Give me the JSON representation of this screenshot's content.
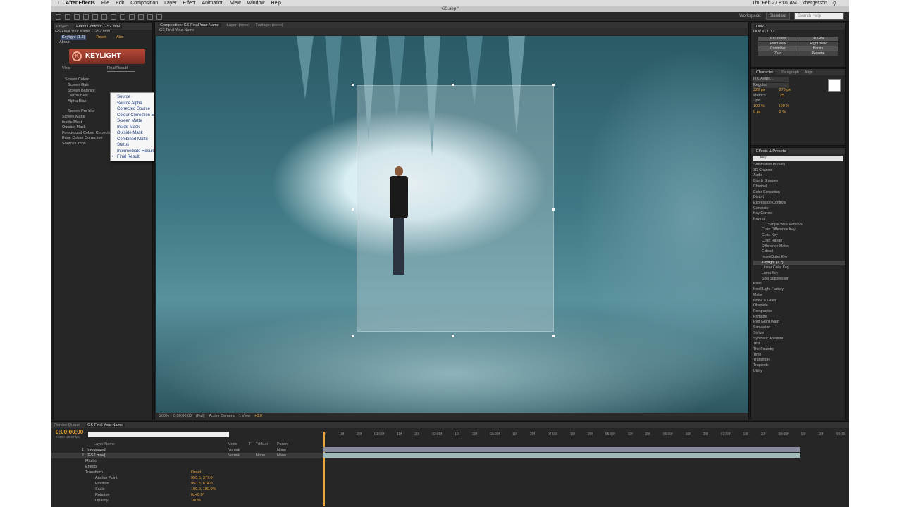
{
  "menubar": {
    "app": "After Effects",
    "items": [
      "File",
      "Edit",
      "Composition",
      "Layer",
      "Effect",
      "Animation",
      "View",
      "Window",
      "Help"
    ],
    "clock": "Thu Feb 27  8:01 AM",
    "user": "kbergerson"
  },
  "window_title": "GS.aep *",
  "workspace": {
    "label": "Workspace:",
    "value": "Standard",
    "search_placeholder": "Search Help"
  },
  "effect_panel": {
    "tabs": [
      "Project",
      "Effect Controls: GS2.mov"
    ],
    "layer": "GS Final Your Name • GS2.mov",
    "effect_name": "Keylight (1.2)",
    "reset": "Reset",
    "about_short": "Abo",
    "about": "About",
    "logo_text": "KEYLIGHT",
    "view_label": "View",
    "view_value": "Final Result",
    "items": [
      "Screen Colour",
      "Screen Gain",
      "Screen Balance",
      "Despill Bias",
      "Alpha Bias",
      "Screen Pre-blur",
      "Screen Matte",
      "Inside Mask",
      "Outside Mask",
      "Foreground Colour Correctio",
      "Edge Colour Correction",
      "Source Crops"
    ],
    "dropdown": [
      "Source",
      "Source Alpha",
      "Corrected Source",
      "Colour Correction Edges",
      "Screen Matte",
      "Inside Mask",
      "Outside Mask",
      "Combined Matte",
      "Status",
      "Intermediate Result",
      "Final Result"
    ],
    "dropdown_selected": "Final Result"
  },
  "viewer": {
    "tab": "Composition: GS Final Your Name",
    "layer_tab": "Layer: (none)",
    "footage_tab": "Footage: (none)",
    "comp_tab": "GS Final Your Name",
    "bottom": [
      "200%",
      "0;00;00;00",
      "(Full)",
      "Active Camera",
      "1 View",
      "+0.0"
    ]
  },
  "duik": {
    "title": "Duik",
    "version": "Duik v13.0.2",
    "buttons": [
      "3D Creator",
      "3D Goal",
      "Front view",
      "Right view",
      "Controller",
      "Bones",
      "Zero",
      "Rename"
    ]
  },
  "character": {
    "tabs": [
      "Character",
      "Paragraph",
      "Align"
    ],
    "font": "ITC Avant...",
    "style": "Regular",
    "size": "229 px",
    "leading": "278 px",
    "kerning": "Metrics",
    "tracking": "25",
    "unit": "- px",
    "vscale": "100 %",
    "hscale": "100 %",
    "baseline": "0 px",
    "tsume": "0 %"
  },
  "effects_presets": {
    "title": "Effects & Presets",
    "search": "key",
    "items": [
      "* Animation Presets",
      "3D Channel",
      "Audio",
      "Blur & Sharpen",
      "Channel",
      "Color Correction",
      "Distort",
      "Expression Controls",
      "Generate",
      "Key Correct",
      "Keying"
    ],
    "keying": [
      "CC Simple Wire Removal",
      "Color Difference Key",
      "Color Key",
      "Color Range",
      "Difference Matte",
      "Extract",
      "Inner/Outer Key",
      "Keylight (1.2)",
      "Linear Color Key",
      "Luma Key",
      "Spill Suppressor"
    ],
    "more": [
      "Knoll",
      "Knoll Light Factory",
      "Matte",
      "Noise & Grain",
      "Obsolete",
      "Perspective",
      "Primatte",
      "Red Giant Warp",
      "Simulation",
      "Stylize",
      "Synthetic Aperture",
      "Text",
      "The Foundry",
      "Time",
      "Transition",
      "Trapcode",
      "Utility"
    ]
  },
  "timeline": {
    "tabs": [
      "Render Queue",
      "GS Final Your Name"
    ],
    "timecode": "0;00;00;00",
    "frames": "00000 (29.97 fps)",
    "search": "",
    "headers": [
      "Layer Name",
      "Mode",
      "T",
      "TrkMat",
      "Parent"
    ],
    "layers": [
      {
        "num": "1",
        "name": "foreground",
        "mode": "Normal",
        "parent": "None"
      },
      {
        "num": "2",
        "name": "[GS2.mov]",
        "mode": "Normal",
        "trk": "None",
        "parent": "None"
      }
    ],
    "props": [
      "Masks",
      "Effects",
      "Transform"
    ],
    "transform": [
      {
        "name": "Anchor Point",
        "value": "953.5, 377.0"
      },
      {
        "name": "Position",
        "value": "953.5, 674.0"
      },
      {
        "name": "Scale",
        "value": "100.0, 100.0%"
      },
      {
        "name": "Rotation",
        "value": "0x+0.0°"
      },
      {
        "name": "Opacity",
        "value": "100%"
      }
    ],
    "reset": "Reset",
    "ruler": [
      "0f",
      "10f",
      "20f",
      "01:00f",
      "10f",
      "20f",
      "02:00f",
      "10f",
      "20f",
      "03:00f",
      "10f",
      "20f",
      "04:00f",
      "10f",
      "20f",
      "05:00f",
      "10f",
      "20f",
      "06:00f",
      "10f",
      "20f",
      "07:00f",
      "10f",
      "20f",
      "08:00f",
      "10f",
      "20f",
      "09:00"
    ]
  },
  "colors": {
    "accent": "#e8a63a",
    "keylight": "#b54a3a"
  }
}
